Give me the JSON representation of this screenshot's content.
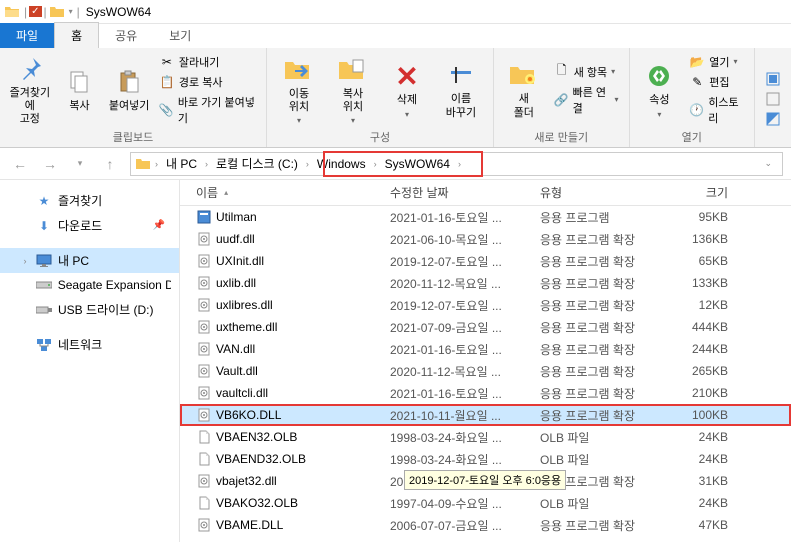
{
  "titlebar": {
    "title": "SysWOW64"
  },
  "tabs": {
    "file": "파일",
    "home": "홈",
    "share": "공유",
    "view": "보기"
  },
  "ribbon": {
    "pin": "즐겨찾기에\n고정",
    "copy": "복사",
    "paste": "붙여넣기",
    "cut": "잘라내기",
    "copy_path": "경로 복사",
    "paste_shortcut": "바로 가기 붙여넣기",
    "clipboard": "클립보드",
    "move_to": "이동\n위치",
    "copy_to": "복사\n위치",
    "delete": "삭제",
    "rename": "이름\n바꾸기",
    "organize": "구성",
    "new_folder": "새\n폴더",
    "new_item": "새 항목",
    "easy_access": "빠른 연결",
    "new": "새로 만들기",
    "properties": "속성",
    "open": "열기",
    "edit": "편집",
    "history": "히스토리",
    "open_group": "열기"
  },
  "breadcrumb": {
    "items": [
      "내 PC",
      "로컬 디스크 (C:)",
      "Windows",
      "SysWOW64"
    ]
  },
  "sidebar": {
    "favorites": "즐겨찾기",
    "downloads": "다운로드",
    "this_pc": "내 PC",
    "seagate": "Seagate Expansion D",
    "usb": "USB 드라이브 (D:)",
    "network": "네트워크"
  },
  "columns": {
    "name": "이름",
    "date": "수정한 날짜",
    "type": "유형",
    "size": "크기"
  },
  "files": [
    {
      "name": "Utilman",
      "date": "2021-01-16-토요일 ...",
      "type": "응용 프로그램",
      "size": "95KB",
      "icon": "app"
    },
    {
      "name": "uudf.dll",
      "date": "2021-06-10-목요일 ...",
      "type": "응용 프로그램 확장",
      "size": "136KB",
      "icon": "dll"
    },
    {
      "name": "UXInit.dll",
      "date": "2019-12-07-토요일 ...",
      "type": "응용 프로그램 확장",
      "size": "65KB",
      "icon": "dll"
    },
    {
      "name": "uxlib.dll",
      "date": "2020-11-12-목요일 ...",
      "type": "응용 프로그램 확장",
      "size": "133KB",
      "icon": "dll"
    },
    {
      "name": "uxlibres.dll",
      "date": "2019-12-07-토요일 ...",
      "type": "응용 프로그램 확장",
      "size": "12KB",
      "icon": "dll"
    },
    {
      "name": "uxtheme.dll",
      "date": "2021-07-09-금요일 ...",
      "type": "응용 프로그램 확장",
      "size": "444KB",
      "icon": "dll"
    },
    {
      "name": "VAN.dll",
      "date": "2021-01-16-토요일 ...",
      "type": "응용 프로그램 확장",
      "size": "244KB",
      "icon": "dll"
    },
    {
      "name": "Vault.dll",
      "date": "2020-11-12-목요일 ...",
      "type": "응용 프로그램 확장",
      "size": "265KB",
      "icon": "dll"
    },
    {
      "name": "vaultcli.dll",
      "date": "2021-01-16-토요일 ...",
      "type": "응용 프로그램 확장",
      "size": "210KB",
      "icon": "dll"
    },
    {
      "name": "VB6KO.DLL",
      "date": "2021-10-11-월요일 ...",
      "type": "응용 프로그램 확장",
      "size": "100KB",
      "icon": "dll",
      "selected": true,
      "highlighted": true
    },
    {
      "name": "VBAEN32.OLB",
      "date": "1998-03-24-화요일 ...",
      "type": "OLB 파일",
      "size": "24KB",
      "icon": "file"
    },
    {
      "name": "VBAEND32.OLB",
      "date": "1998-03-24-화요일 ...",
      "type": "OLB 파일",
      "size": "24KB",
      "icon": "file"
    },
    {
      "name": "vbajet32.dll",
      "date": "2019-12-07-토요일 ...",
      "type": "응용 프로그램 확장",
      "size": "31KB",
      "icon": "dll",
      "tooltip": "2019-12-07-토요일 오후 6:0응용"
    },
    {
      "name": "VBAKO32.OLB",
      "date": "1997-04-09-수요일 ...",
      "type": "OLB 파일",
      "size": "24KB",
      "icon": "file"
    },
    {
      "name": "VBAME.DLL",
      "date": "2006-07-07-금요일 ...",
      "type": "응용 프로그램 확장",
      "size": "47KB",
      "icon": "dll"
    }
  ]
}
